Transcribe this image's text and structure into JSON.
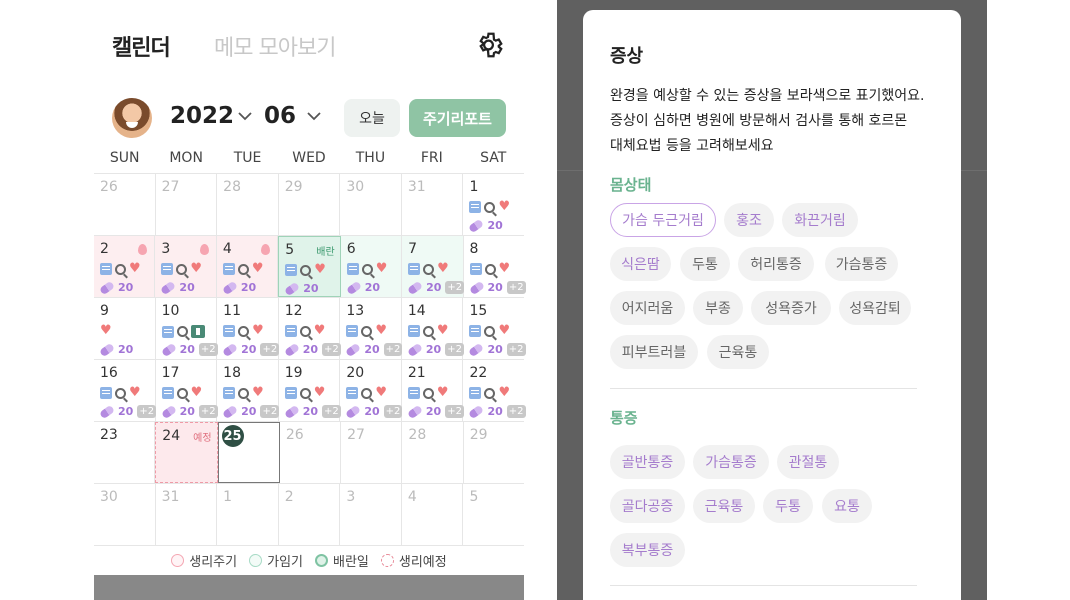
{
  "calendar": {
    "tabs": {
      "calendar": "캘린더",
      "memo": "메모 모아보기"
    },
    "year": "2022",
    "month": "06",
    "today_button": "오늘",
    "report_button": "주기리포트",
    "weekdays": [
      "SUN",
      "MON",
      "TUE",
      "WED",
      "THU",
      "FRI",
      "SAT"
    ],
    "tags": {
      "ovulation": "배란",
      "expected": "예정"
    },
    "med_count": "20",
    "more": "+2",
    "weeks": [
      [
        {
          "d": "26",
          "out": true
        },
        {
          "d": "27",
          "out": true
        },
        {
          "d": "28",
          "out": true
        },
        {
          "d": "29",
          "out": true
        },
        {
          "d": "30",
          "out": true
        },
        {
          "d": "31",
          "out": true
        },
        {
          "d": "1",
          "icons": [
            "memo",
            "zoom",
            "heart"
          ],
          "med": true
        }
      ],
      [
        {
          "d": "2",
          "state": "period",
          "drop": true,
          "icons": [
            "memo",
            "zoom",
            "heart"
          ],
          "med": true
        },
        {
          "d": "3",
          "state": "period",
          "drop": true,
          "icons": [
            "memo",
            "zoom",
            "heart"
          ],
          "med": true
        },
        {
          "d": "4",
          "state": "period",
          "drop": true,
          "icons": [
            "memo",
            "zoom",
            "heart"
          ],
          "med": true
        },
        {
          "d": "5",
          "state": "ovul",
          "tag": "ovul",
          "icons": [
            "memo",
            "zoom",
            "heart"
          ],
          "med": true
        },
        {
          "d": "6",
          "state": "fertile",
          "icons": [
            "memo",
            "zoom",
            "heart"
          ],
          "med": true
        },
        {
          "d": "7",
          "state": "fertile",
          "icons": [
            "memo",
            "zoom",
            "heart"
          ],
          "med": true,
          "more": true
        },
        {
          "d": "8",
          "icons": [
            "memo",
            "zoom",
            "heart"
          ],
          "med": true,
          "more": true
        }
      ],
      [
        {
          "d": "9",
          "icons": [
            "heart"
          ],
          "med": true
        },
        {
          "d": "10",
          "icons": [
            "memo",
            "zoom",
            "hosp"
          ],
          "med": true,
          "more": true
        },
        {
          "d": "11",
          "icons": [
            "memo",
            "zoom",
            "heart"
          ],
          "med": true,
          "more": true
        },
        {
          "d": "12",
          "icons": [
            "memo",
            "zoom",
            "heart"
          ],
          "med": true,
          "more": true
        },
        {
          "d": "13",
          "icons": [
            "memo",
            "zoom",
            "heart"
          ],
          "med": true,
          "more": true
        },
        {
          "d": "14",
          "icons": [
            "memo",
            "zoom",
            "heart"
          ],
          "med": true,
          "more": true
        },
        {
          "d": "15",
          "icons": [
            "memo",
            "zoom",
            "heart"
          ],
          "med": true,
          "more": true
        }
      ],
      [
        {
          "d": "16",
          "icons": [
            "memo",
            "zoom",
            "heart"
          ],
          "med": true,
          "more": true
        },
        {
          "d": "17",
          "icons": [
            "memo",
            "zoom",
            "heart"
          ],
          "med": true,
          "more": true
        },
        {
          "d": "18",
          "icons": [
            "memo",
            "zoom",
            "heart"
          ],
          "med": true,
          "more": true
        },
        {
          "d": "19",
          "icons": [
            "memo",
            "zoom",
            "heart"
          ],
          "med": true,
          "more": true
        },
        {
          "d": "20",
          "icons": [
            "memo",
            "zoom",
            "heart"
          ],
          "med": true,
          "more": true
        },
        {
          "d": "21",
          "icons": [
            "memo",
            "zoom",
            "heart"
          ],
          "med": true,
          "more": true
        },
        {
          "d": "22",
          "icons": [
            "memo",
            "zoom",
            "heart"
          ],
          "med": true,
          "more": true
        }
      ],
      [
        {
          "d": "23"
        },
        {
          "d": "24",
          "state": "expect",
          "tag": "exp"
        },
        {
          "d": "25",
          "state": "today"
        },
        {
          "d": "26",
          "out": true
        },
        {
          "d": "27",
          "out": true
        },
        {
          "d": "28",
          "out": true
        },
        {
          "d": "29",
          "out": true
        }
      ],
      [
        {
          "d": "30",
          "out": true
        },
        {
          "d": "31",
          "out": true
        },
        {
          "d": "1",
          "out": true
        },
        {
          "d": "2",
          "out": true
        },
        {
          "d": "3",
          "out": true
        },
        {
          "d": "4",
          "out": true
        },
        {
          "d": "5",
          "out": true
        }
      ]
    ],
    "legend": [
      "생리주기",
      "가임기",
      "배란일",
      "생리예정"
    ]
  },
  "symptoms": {
    "title": "증상",
    "description": [
      "완경을 예상할 수 있는 증상을 보라색으로 표기했어요.",
      "증상이 심하면 병원에 방문해서 검사를 통해 호르몬",
      "대체요법 등을 고려해보세요"
    ],
    "sections": [
      {
        "name": "몸상태",
        "chips": [
          {
            "label": "가슴 두근거림",
            "style": "sel"
          },
          {
            "label": "홍조",
            "style": "purple"
          },
          {
            "label": "화끈거림",
            "style": "purple"
          },
          {
            "label": "식은땀",
            "style": "purple"
          },
          {
            "label": "두통",
            "style": ""
          },
          {
            "label": "허리통증",
            "style": ""
          },
          {
            "label": "가슴통증",
            "style": ""
          },
          {
            "label": "어지러움",
            "style": ""
          },
          {
            "label": "부종",
            "style": ""
          },
          {
            "label": "성욕증가",
            "style": ""
          },
          {
            "label": "성욕감퇴",
            "style": ""
          },
          {
            "label": "피부트러블",
            "style": ""
          },
          {
            "label": "근육통",
            "style": ""
          }
        ]
      },
      {
        "name": "통증",
        "chips": [
          {
            "label": "골반통증",
            "style": "purple"
          },
          {
            "label": "가슴통증",
            "style": "purple"
          },
          {
            "label": "관절통",
            "style": "purple"
          },
          {
            "label": "골다공증",
            "style": "purple"
          },
          {
            "label": "근육통",
            "style": "purple"
          },
          {
            "label": "두통",
            "style": "purple"
          },
          {
            "label": "요통",
            "style": "purple"
          },
          {
            "label": "복부통증",
            "style": "purple"
          }
        ]
      }
    ]
  }
}
